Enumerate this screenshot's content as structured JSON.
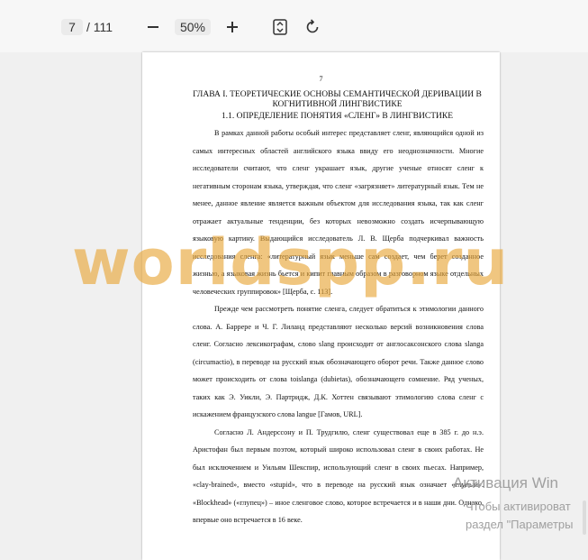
{
  "toolbar": {
    "current_page": "7",
    "total_pages": "/ 111",
    "zoom": "50%",
    "zoom_out_icon": "minus-icon",
    "zoom_in_icon": "plus-icon",
    "fit_icon": "fit-page-icon",
    "rotate_icon": "rotate-icon"
  },
  "document": {
    "page_number": "7",
    "chapter_title": "ГЛАВА I. ТЕОРЕТИЧЕСКИЕ ОСНОВЫ СЕМАНТИЧЕСКОЙ ДЕРИВАЦИИ В КОГНИТИВНОЙ ЛИНГВИСТИКЕ",
    "section_title": "1.1. ОПРЕДЕЛЕНИЕ ПОНЯТИЯ «СЛЕНГ» В ЛИНГВИСТИКЕ",
    "paragraphs": [
      "В рамках данной работы особый интерес представляет сленг, являющийся одной из самых интересных областей английского языка ввиду его неоднозначности. Многие исследователи считают, что сленг украшает язык, другие ученые относят сленг к негативным сторонам языка, утверждая, что сленг «загрязняет» литературный язык. Тем не менее, данное явление является важным объектом для исследования языка, так как сленг отражает актуальные тенденции, без которых невозможно создать исчерпывающую языковую картину. Выдающийся исследователь Л. В. Щерба подчеркивал важность исследования сленга: «литературный язык меньше сам создает, чем берет созданное жизнью, а языковая жизнь бьется и кипит главным образом в разговорном языке отдельных человеческих группировок» [Щерба, с. 113].",
      "Прежде чем рассмотреть понятие сленга, следует обратиться к этимологии данного слова. А. Баррере и Ч. Г. Лиланд представляют несколько версий возникновения слова сленг. Согласно лексикографам, слово slang происходит от англосаксонского слова slanga (circumactio), в переводе на русский язык обозначающего оборот речи. Также данное слово может происходить от слова toislanga (dubietas), обозначающего сомнение. Ряд ученых, таких как Э. Уикли, Э. Партридж, Д.К. Хоттен связывают этимологию слова сленг с искажением французского слова langue [Гамов, URL].",
      "Согласно Л. Андерссону и П. Трудгилю, сленг существовал еще в 385 г. до н.э. Аристофан был первым поэтом, который широко использовал сленг в своих работах. Не был исключением и Уильям Шекспир, использующий сленг в своих пьесах. Например, «clay-brained», вместо «stupid», что в переводе на русский язык означает «глупый». «Blockhead» («глупец») – иное сленговое слово, которое встречается и в наши дни. Однако, впервые оно встречается в 16 веке."
    ]
  },
  "watermark": "worldspp.ru",
  "os_overlay": {
    "title": "Активация Win",
    "line1": "Чтобы активироват",
    "line2": "раздел \"Параметры"
  }
}
